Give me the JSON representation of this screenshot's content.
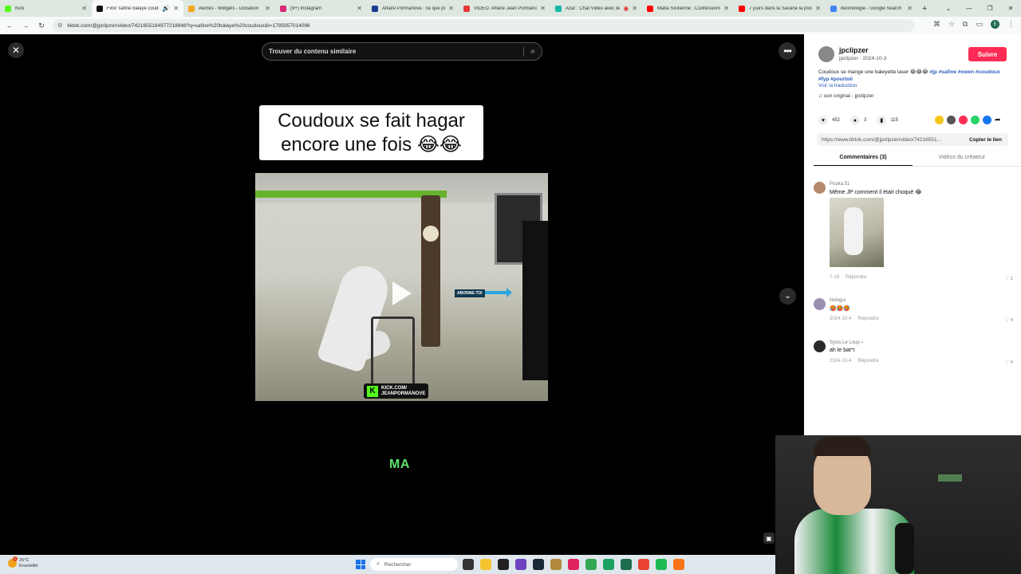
{
  "browser": {
    "tabs": [
      {
        "label": "Kick",
        "color": "#53fc18",
        "active": false
      },
      {
        "label": "Find 'safine balaye coudo",
        "color": "#111111",
        "active": true
      },
      {
        "label": "Alertes - Widgets - Donation",
        "color": "#f4a81d",
        "active": false
      },
      {
        "label": "(9+) Instagram",
        "color": "#d62976",
        "active": false
      },
      {
        "label": "Affaire Pormanove : ce que pr",
        "color": "#1a3c8f",
        "active": false
      },
      {
        "label": "VIDEO. Affaire Jean Pormanov",
        "color": "#e53935",
        "active": false
      },
      {
        "label": "Azar : Chat Vidéo avec de",
        "color": "#14b8a6",
        "active": false
      },
      {
        "label": "Mafia Sicilienne : Confessions",
        "color": "#ff0000",
        "active": false
      },
      {
        "label": "7 jours dans la Savane la plus",
        "color": "#ff0000",
        "active": false
      },
      {
        "label": "deontologie - Google Search",
        "color": "#4285f4",
        "active": false
      }
    ],
    "url": "tiktok.com/@jpclipzer/video/7421655184977218848?q=safine%20balaye%20coudoux&t=1785957014096"
  },
  "viewer": {
    "search_placeholder": "Trouver du contenu similaire",
    "caption": "Coudoux se fait hagar encore une fois 😂😂",
    "overlay_abonne": "ABONNE-TOI",
    "kick_line1": "KICK.COM/",
    "kick_line2": "JEANPORMANOVE",
    "subtitle": "MA"
  },
  "sidebar": {
    "username": "jpclipzer",
    "handle_date": "jpclipzer · 2024-10-3",
    "follow_label": "Suivre",
    "desc_text": "Coudoux se mange une baleyette laser 😂😂😂 ",
    "desc_tags": "#jp #safine #owen #coudoux #fyp #pourtoii",
    "translate": "Voir la traduction",
    "sound": "son original - jpclipzer",
    "likes": "452",
    "comments_count": "3",
    "saves": "115",
    "link": "https://www.tiktok.com/@jpclipzer/video/74216551...",
    "copy_label": "Copier le lien",
    "tab_comments": "Commentaires (3)",
    "tab_videos": "Vidéos du créateur",
    "comments": [
      {
        "name": "Pouka.51",
        "text": "Même JP comment il était choqué 😂",
        "date": "7-19",
        "reply": "Répondre",
        "likes": "1"
      },
      {
        "name": "Nxingui",
        "text": "🥵🥵🥵",
        "date": "2024-10-4",
        "reply": "Répondre",
        "likes": "4"
      },
      {
        "name": "Sysis Le Loup",
        "text": "ah le bat*r",
        "date": "2024-10-4",
        "reply": "Répondre",
        "likes": "4"
      }
    ]
  },
  "taskbar": {
    "temp": "26°C",
    "weather": "Ensoleillé",
    "search": "Rechercher"
  }
}
